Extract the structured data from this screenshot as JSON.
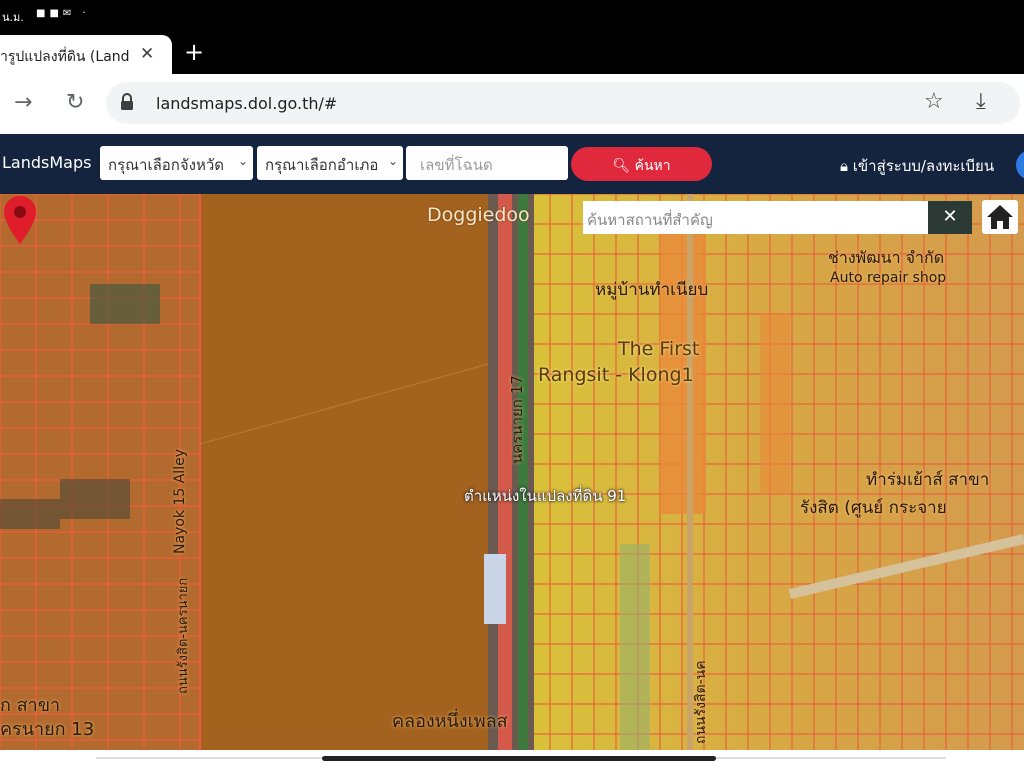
{
  "status_bar": {
    "text": "น.ม.",
    "icons": [
      "facebook-icon",
      "gallery-icon",
      "mail-icon"
    ]
  },
  "browser": {
    "tab_title": "ารูปแปลงที่ดิน (Land",
    "tab_close": "✕",
    "new_tab": "+",
    "url": "landsmaps.dol.go.th/#"
  },
  "site": {
    "brand": "LandsMaps",
    "province_select": "กรุณาเลือกจังหวัด",
    "district_select": "กรุณาเลือกอำเภอ",
    "parcel_placeholder": "เลขที่โฉนด",
    "search_label": "ค้นหา",
    "login_label": "เข้าสู่ระบบ/ลงทะเบียน"
  },
  "map": {
    "place_search_placeholder": "ค้นหาสถานที่สำคัญ",
    "clear": "✕",
    "pin_label": "ตำแหน่งในแปลงที่ดิน 91",
    "labels": {
      "doggiedoo": "Doggiedoo",
      "auto_repair": "Auto repair shop",
      "workshop": "ช่างพัฒนา จำกัด",
      "village": "หมู่บ้านทำเนียบ",
      "the_first": "The First",
      "rangsit": "Rangsit - Klong1",
      "alley": "Nayok 15 Alley",
      "rangsit_nayok": "ถนนรังสิต-นครนายก",
      "road_17": "นครนายก 17",
      "canal": "คลองหนึ่งเพลส",
      "branch_left": "ก สาขา",
      "nayok13": "ครนายก 13",
      "center_right": "ทำร่มเย้าส์ สาขา",
      "center_right2": "รังสิต (ศูนย์ กระจาย",
      "road_v": "ถนนรังสิต-นค"
    }
  },
  "colors": {
    "navbar": "#14243f",
    "search_button": "#e0293d",
    "pin": "#e01e2b"
  }
}
